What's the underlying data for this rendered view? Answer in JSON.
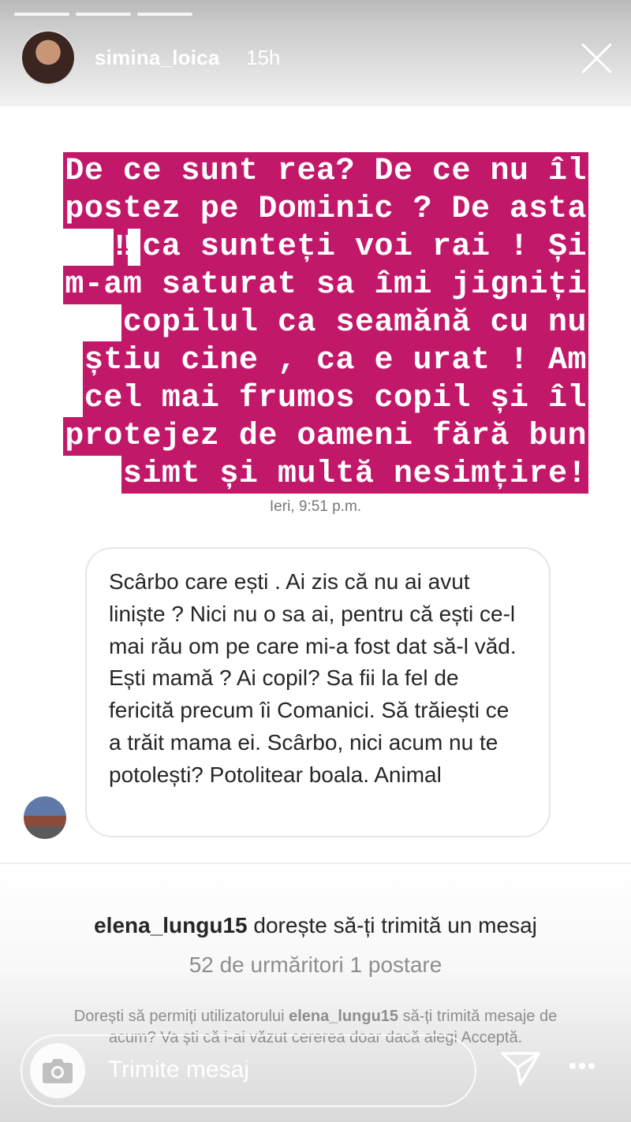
{
  "header": {
    "username": "simina_loica",
    "time": "15h"
  },
  "story_text": {
    "lines": [
      "De ce sunt rea? De ce nu îl",
      "postez pe Dominic ? De asta",
      "ca sunteți voi rai ! Și",
      "m-am saturat sa îmi jigniți",
      "copilul ca seamănă cu nu",
      "știu cine , ca e urat ! Am",
      "cel mai frumos copil și îl",
      "protejez de oameni fără bun",
      "simt și multă nesimțire!"
    ],
    "emoji_marks": "‼",
    "highlight_color": "#c2186a",
    "date": "Ieri, 9:51 p.m."
  },
  "message": {
    "text": "Scârbo care ești . Ai zis că nu ai avut liniște ? Nici nu o sa ai, pentru că ești ce-l mai rău om pe care mi-a fost dat să-l văd. Ești mamă ? Ai copil? Sa fii la fel de fericită precum îi Comanici. Să trăiești ce a trăit mama ei. Scârbo, nici acum nu te potolești? Potolitear boala. Animal"
  },
  "request": {
    "requester": "elena_lungu15",
    "title_suffix": "dorește să-ți trimită un mesaj",
    "stats": "52 de urmăritori 1 postare",
    "desc_prefix": "Dorești să permiți utilizatorului",
    "desc_suffix": "să-ți trimită mesaje de acum? Va ști că i-ai văzut cererea doar dacă alegi Acceptă."
  },
  "reply": {
    "placeholder": "Trimite mesaj"
  },
  "icons": {
    "camera": "camera-icon",
    "send": "send-icon",
    "more": "more-icon",
    "close": "close-icon"
  }
}
